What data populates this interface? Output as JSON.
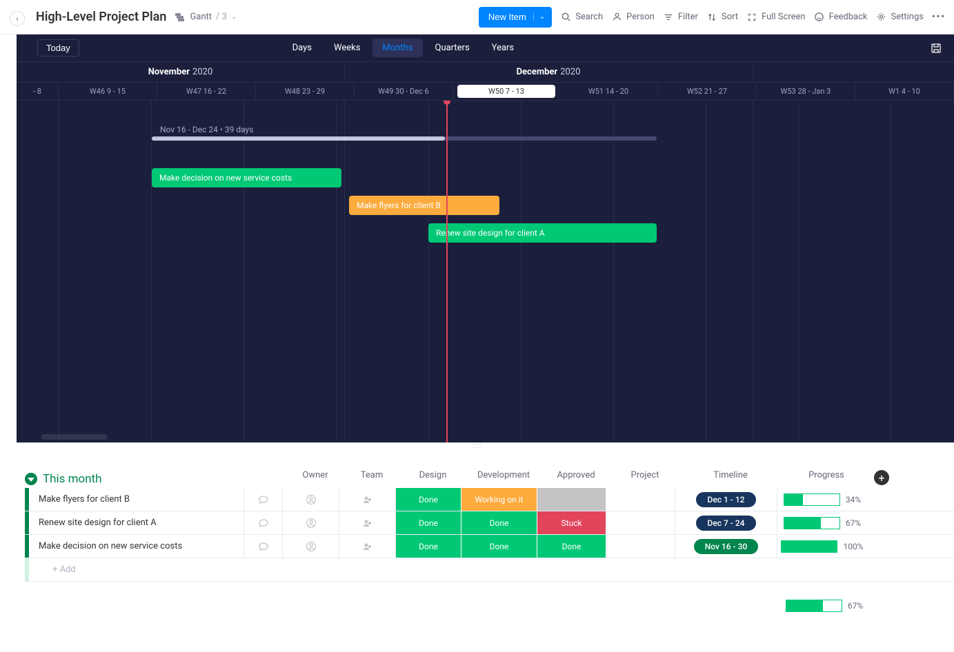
{
  "header": {
    "title": "High-Level Project Plan",
    "view_type": "Gantt",
    "view_count": "/ 3",
    "new_item": "New Item",
    "tools": {
      "search": "Search",
      "person": "Person",
      "filter": "Filter",
      "sort": "Sort",
      "fullscreen": "Full Screen",
      "feedback": "Feedback",
      "settings": "Settings"
    }
  },
  "gantt": {
    "today": "Today",
    "scales": [
      "Days",
      "Weeks",
      "Months",
      "Quarters",
      "Years"
    ],
    "active_scale": "Months",
    "months": [
      {
        "name": "November",
        "year": "2020"
      },
      {
        "name": "December",
        "year": "2020"
      }
    ],
    "weeks": [
      {
        "label": " - 8"
      },
      {
        "label": "W46   9 - 15"
      },
      {
        "label": "W47   16 - 22"
      },
      {
        "label": "W48   23 - 29"
      },
      {
        "label": "W49   30 - Dec 6"
      },
      {
        "label": "W50   7 - 13",
        "current": true
      },
      {
        "label": "W51   14 - 20"
      },
      {
        "label": "W52   21 - 27"
      },
      {
        "label": "W53   28 - Jan 3"
      },
      {
        "label": "W1   4 - 10"
      }
    ],
    "summary_label": "Nov 16 - Dec 24 • 39 days",
    "bars": [
      {
        "label": "Make decision on new service costs",
        "color": "green"
      },
      {
        "label": "Make flyers for client B",
        "color": "orange"
      },
      {
        "label": "Renew site design for client A",
        "color": "green"
      }
    ]
  },
  "table": {
    "group_title": "This month",
    "columns": [
      "Owner",
      "Team",
      "Design",
      "Development",
      "Approved",
      "Project",
      "Timeline",
      "Progress"
    ],
    "rows": [
      {
        "name": "Make flyers for client B",
        "design": "Done",
        "development": "Working on it",
        "approved": "",
        "timeline": "Dec 1 - 12",
        "timeline_style": "dark",
        "progress": 34
      },
      {
        "name": "Renew site design for client A",
        "design": "Done",
        "development": "Done",
        "approved": "Stuck",
        "timeline": "Dec 7 - 24",
        "timeline_style": "dark",
        "progress": 67
      },
      {
        "name": "Make decision on new service costs",
        "design": "Done",
        "development": "Done",
        "approved": "Done",
        "timeline": "Nov 16 - 30",
        "timeline_style": "green",
        "progress": 100
      }
    ],
    "add_row": "+ Add",
    "summary_progress": 67
  }
}
